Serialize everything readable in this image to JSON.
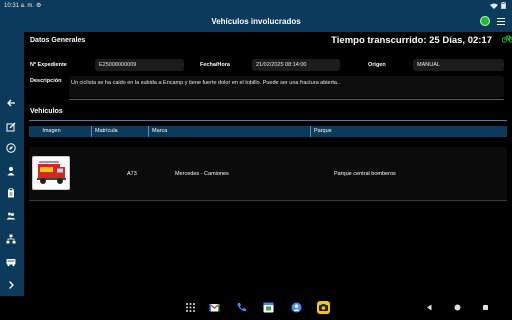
{
  "status_bar": {
    "time": "10:31 a. m.",
    "settings_glyph": "⚙"
  },
  "app_bar": {
    "title": "Vehículos involucrados"
  },
  "general": {
    "section_label": "Datos Generales",
    "elapsed": "Tiempo transcurrido: 25 Días, 02:17",
    "expediente_label": "Nº Expediente",
    "expediente_value": "E25000000009",
    "fecha_label": "Fecha/Hora",
    "fecha_value": "21/02/2025 08:14:00",
    "origen_label": "Origen",
    "origen_value": "MANUAL",
    "descripcion_label": "Descripción",
    "descripcion_value": "Un ciclista se ha caido en la subida a Encamp y tiene fuerte dolor en el tobillo. Puede ser una fractura abierta.."
  },
  "vehicles": {
    "section_label": "Vehículos",
    "columns": [
      "Imagen",
      "Matrícula",
      "Marca",
      "Parque"
    ],
    "rows": [
      {
        "matricula": "A73",
        "marca": "Mercedes - Camiones",
        "parque": "Parque central bomberos"
      }
    ]
  },
  "colors": {
    "accent": "#0c3a5a",
    "status_ok": "#19c02a",
    "fire_truck": "#d8261c"
  },
  "icons": {
    "sidebar": [
      "back-arrow-icon",
      "edit-icon",
      "compass-icon",
      "person-icon",
      "clipboard-icon",
      "people-icon",
      "hierarchy-icon",
      "truck-icon",
      "chevron-right-icon"
    ],
    "nav": [
      "apps-grid-icon",
      "gmail-icon",
      "phone-icon",
      "calendar-icon",
      "contacts-icon",
      "camera-icon",
      "back-triangle-icon",
      "home-circle-icon",
      "recents-square-icon"
    ]
  }
}
